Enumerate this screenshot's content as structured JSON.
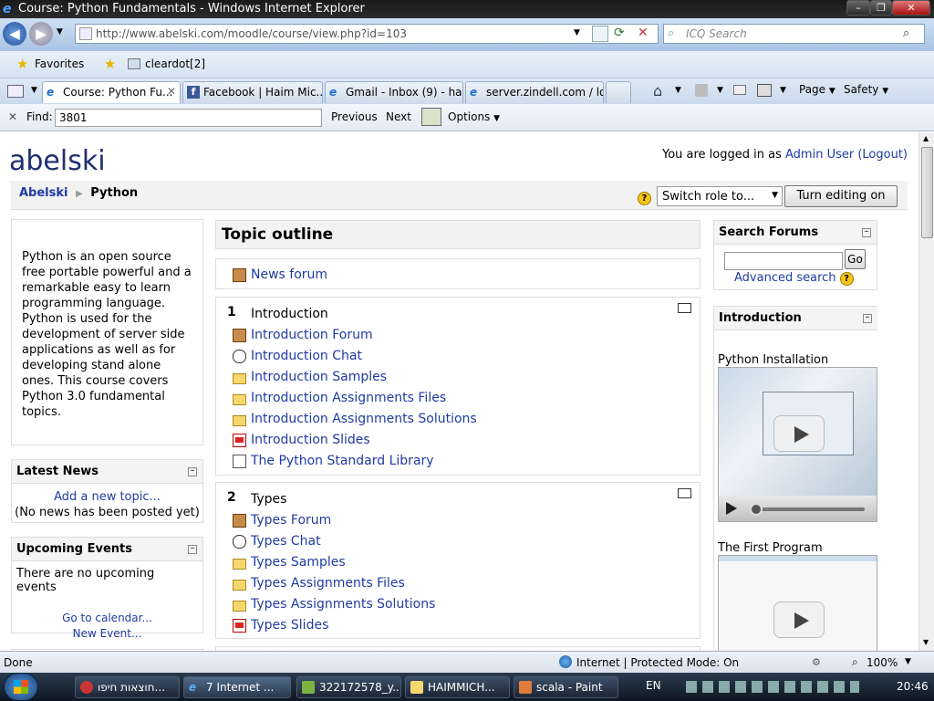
{
  "window": {
    "title": "Course: Python Fundamentals - Windows Internet Explorer"
  },
  "address": {
    "url": "http://www.abelski.com/moodle/course/view.php?id=103",
    "search_placeholder": "ICQ Search"
  },
  "favorites": {
    "label": "Favorites",
    "item": "cleardot[2]"
  },
  "tabs": [
    {
      "label": "Course: Python Fu..."
    },
    {
      "label": "Facebook | Haim Mic..."
    },
    {
      "label": "Gmail - Inbox (9) - hai..."
    },
    {
      "label": "server.zindell.com / lo..."
    }
  ],
  "commandbar": {
    "page": "Page",
    "safety": "Safety"
  },
  "findbar": {
    "label": "Find:",
    "value": "3801",
    "previous": "Previous",
    "next": "Next",
    "options": "Options"
  },
  "site": {
    "name": "abelski",
    "login_prefix": "You are logged in as ",
    "user": "Admin User",
    "logout": "(Logout)",
    "breadcrumb_home": "Abelski",
    "breadcrumb_sep": "▶",
    "breadcrumb_current": "Python",
    "switch_role": "Switch role to...",
    "edit_button": "Turn editing on"
  },
  "left": {
    "summary": "Python is an open source free portable powerful and a remarkable easy to learn programming language. Python is used for the development of server side applications as well as for developing stand alone ones. This course covers Python 3.0 fundamental topics.",
    "news": {
      "title": "Latest News",
      "add": "Add a new topic...",
      "empty": "(No news has been posted yet)"
    },
    "events": {
      "title": "Upcoming Events",
      "empty": "There are no upcoming events",
      "calendar": "Go to calendar...",
      "new_event": "New Event..."
    }
  },
  "center": {
    "title": "Topic outline",
    "news_forum": "News forum",
    "sections": [
      {
        "num": "1",
        "title": "Introduction",
        "items": [
          {
            "icon": "forum",
            "label": "Introduction Forum"
          },
          {
            "icon": "chat",
            "label": "Introduction Chat"
          },
          {
            "icon": "folder",
            "label": "Introduction Samples"
          },
          {
            "icon": "folder",
            "label": "Introduction Assignments Files"
          },
          {
            "icon": "folder",
            "label": "Introduction Assignments Solutions"
          },
          {
            "icon": "pdf",
            "label": "Introduction Slides"
          },
          {
            "icon": "doc",
            "label": "The Python Standard Library"
          }
        ]
      },
      {
        "num": "2",
        "title": "Types",
        "items": [
          {
            "icon": "forum",
            "label": "Types Forum"
          },
          {
            "icon": "chat",
            "label": "Types Chat"
          },
          {
            "icon": "folder",
            "label": "Types Samples"
          },
          {
            "icon": "folder",
            "label": "Types Assignments Files"
          },
          {
            "icon": "folder",
            "label": "Types Assignments Solutions"
          },
          {
            "icon": "pdf",
            "label": "Types Slides"
          }
        ]
      }
    ]
  },
  "right": {
    "search": {
      "title": "Search Forums",
      "go": "Go",
      "advanced": "Advanced search"
    },
    "intro": {
      "title": "Introduction",
      "video1": "Python Installation",
      "video2": "The First Program"
    }
  },
  "status": {
    "left": "Done",
    "zone": "Internet | Protected Mode: On",
    "zoom": "100%"
  },
  "taskbar": {
    "items": [
      "חוצאות חיפו...",
      "7 Internet ...",
      "322172578_y...",
      "HAIMMICH...",
      "scala - Paint"
    ],
    "lang": "EN",
    "clock": "20:46"
  }
}
